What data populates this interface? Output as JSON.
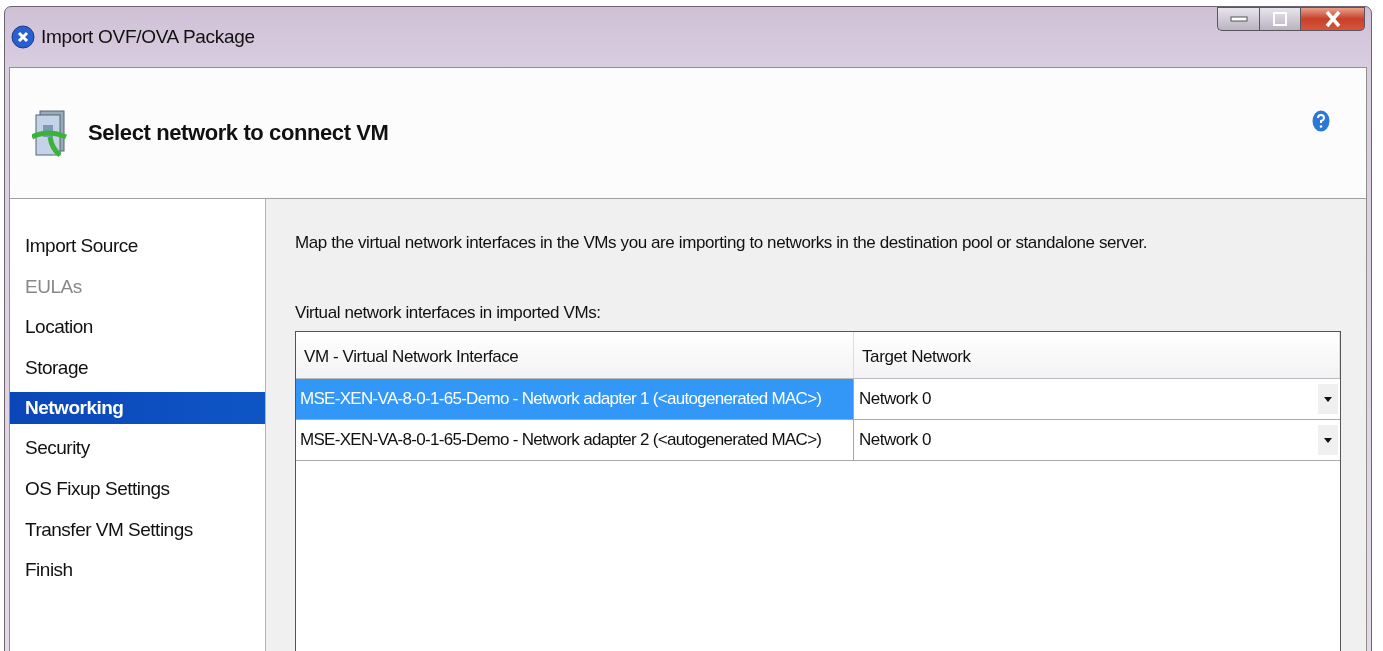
{
  "window": {
    "title": "Import OVF/OVA Package"
  },
  "header": {
    "title": "Select network to connect VM"
  },
  "sidebar": {
    "items": [
      {
        "label": "Import Source",
        "selected": false,
        "disabled": false
      },
      {
        "label": "EULAs",
        "selected": false,
        "disabled": true
      },
      {
        "label": "Location",
        "selected": false,
        "disabled": false
      },
      {
        "label": "Storage",
        "selected": false,
        "disabled": false
      },
      {
        "label": "Networking",
        "selected": true,
        "disabled": false
      },
      {
        "label": "Security",
        "selected": false,
        "disabled": false
      },
      {
        "label": "OS Fixup Settings",
        "selected": false,
        "disabled": false
      },
      {
        "label": "Transfer VM Settings",
        "selected": false,
        "disabled": false
      },
      {
        "label": "Finish",
        "selected": false,
        "disabled": false
      }
    ]
  },
  "description": "Map the virtual network interfaces in the VMs you are importing to networks in the destination pool or standalone server.",
  "table": {
    "caption": "Virtual network interfaces in imported VMs:",
    "columns": [
      "VM - Virtual Network Interface",
      "Target Network"
    ],
    "rows": [
      {
        "interface": "MSE-XEN-VA-8-0-1-65-Demo - Network adapter 1 (<autogenerated MAC>)",
        "network": "Network 0",
        "selected": true
      },
      {
        "interface": "MSE-XEN-VA-8-0-1-65-Demo - Network adapter 2 (<autogenerated MAC>)",
        "network": "Network 0",
        "selected": false
      }
    ]
  }
}
